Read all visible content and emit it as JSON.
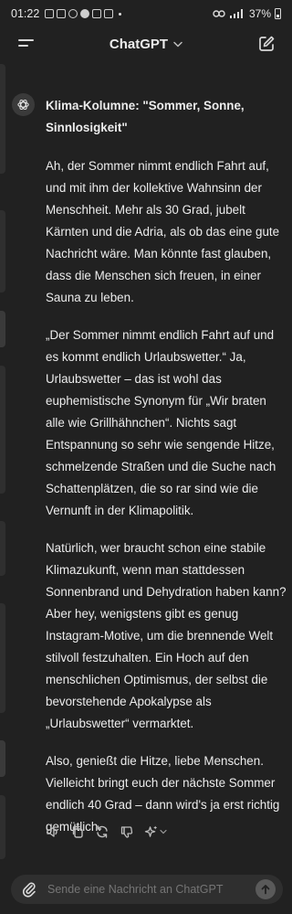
{
  "statusbar": {
    "time": "01:22",
    "battery": "37%"
  },
  "header": {
    "title": "ChatGPT",
    "menu_icon": "hamburger-menu-icon",
    "new_chat_icon": "edit-icon"
  },
  "message": {
    "heading": "Klima-Kolumne: \"Sommer, Sonne, Sinnlosigkeit\"",
    "paragraphs": [
      "Ah, der Sommer nimmt endlich Fahrt auf, und mit ihm der kollektive Wahnsinn der Menschheit. Mehr als 30 Grad, jubelt Kärnten und die Adria, als ob das eine gute Nachricht wäre. Man könnte fast glauben, dass die Menschen sich freuen, in einer Sauna zu leben.",
      "„Der Sommer nimmt endlich Fahrt auf und es kommt endlich Urlaubswetter.“ Ja, Urlaubswetter – das ist wohl das euphemistische Synonym für „Wir braten alle wie Grillhähnchen“. Nichts sagt Entspannung so sehr wie sengende Hitze, schmelzende Straßen und die Suche nach Schattenplätzen, die so rar sind wie die Vernunft in der Klimapolitik.",
      "Natürlich, wer braucht schon eine stabile Klimazukunft, wenn man stattdessen Sonnenbrand und Dehydration haben kann? Aber hey, wenigstens gibt es genug Instagram-Motive, um die brennende Welt stilvoll festzuhalten. Ein Hoch auf den menschlichen Optimismus, der selbst die bevorstehende Apokalypse als „Urlaubswetter“ vermarktet.",
      "Also, genießt die Hitze, liebe Menschen. Vielleicht bringt euch der nächste Sommer endlich 40 Grad – dann wird's ja erst richtig gemütlich."
    ]
  },
  "actions": [
    "speaker-icon",
    "copy-icon",
    "regenerate-icon",
    "thumbs-down-icon",
    "sparkle-model-icon"
  ],
  "composer": {
    "placeholder": "Sende eine Nachricht an ChatGPT",
    "attach_icon": "paperclip-icon",
    "send_icon": "arrow-up-icon"
  },
  "colors": {
    "background": "#212121",
    "composer": "#2f2f2f",
    "text": "#ececec",
    "muted": "#9b9b9b"
  }
}
